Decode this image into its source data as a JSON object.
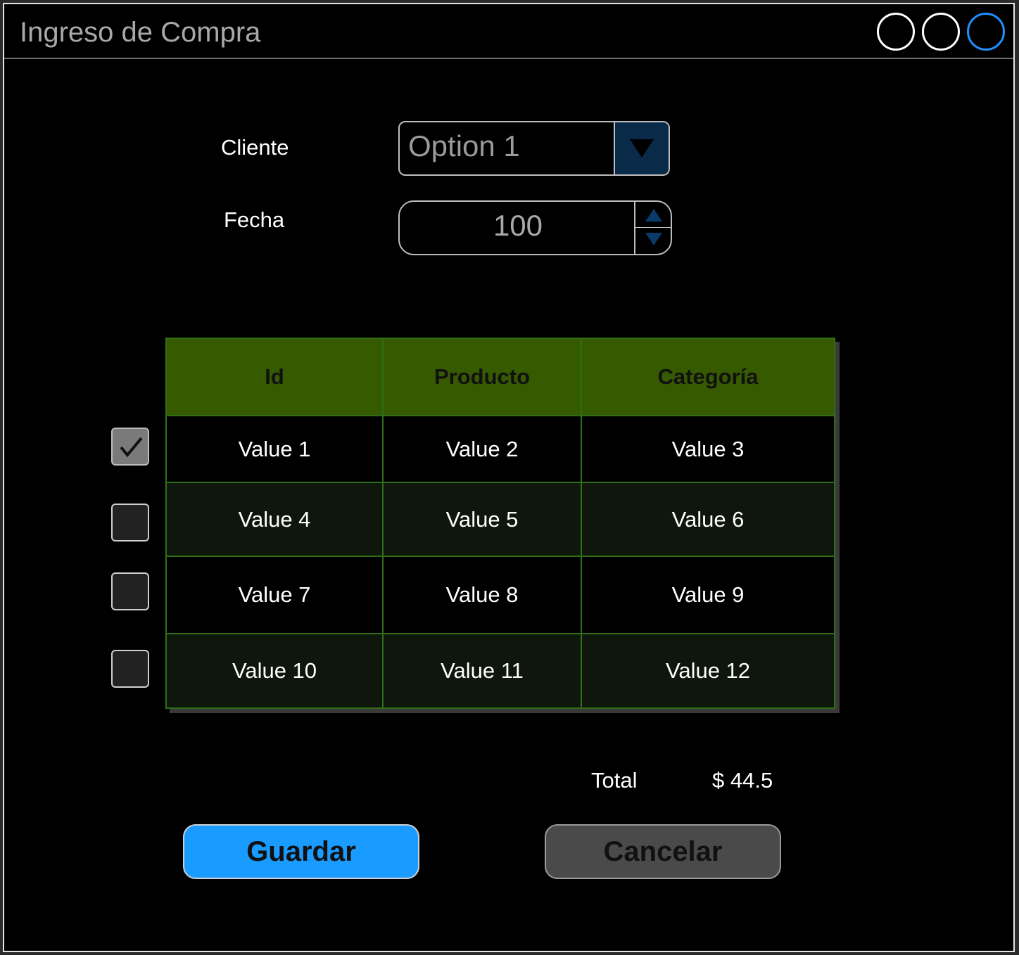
{
  "window": {
    "title": "Ingreso de Compra",
    "controls": [
      "minimize",
      "maximize",
      "close"
    ]
  },
  "form": {
    "cliente_label": "Cliente",
    "cliente_value": "Option 1",
    "fecha_label": "Fecha",
    "fecha_value": "100"
  },
  "table": {
    "columns": [
      "Id",
      "Producto",
      "Categoría"
    ],
    "rows": [
      {
        "checked": true,
        "cells": [
          "Value 1",
          "Value 2",
          "Value 3"
        ]
      },
      {
        "checked": false,
        "cells": [
          "Value 4",
          "Value 5",
          "Value 6"
        ]
      },
      {
        "checked": false,
        "cells": [
          "Value 7",
          "Value 8",
          "Value 9"
        ]
      },
      {
        "checked": false,
        "cells": [
          "Value 10",
          "Value 11",
          "Value 12"
        ]
      }
    ]
  },
  "summary": {
    "total_label": "Total",
    "total_value": "$ 44.5"
  },
  "actions": {
    "save_label": "Guardar",
    "cancel_label": "Cancelar"
  },
  "colors": {
    "header_bg": "#355a00",
    "grid_border": "#2f6f1a",
    "save_button": "#1a9bff",
    "cancel_button": "#4a4a4a",
    "active_control": "#1e90ff"
  }
}
